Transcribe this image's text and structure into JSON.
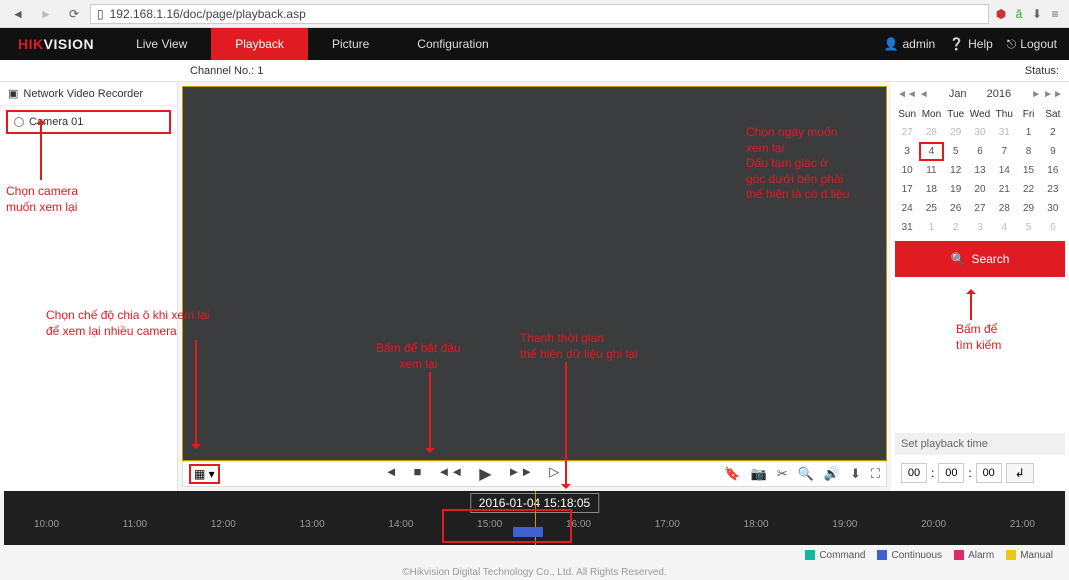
{
  "browser": {
    "url": "192.168.1.16/doc/page/playback.asp"
  },
  "logo": {
    "prefix": "HIK",
    "suffix": "VISION"
  },
  "nav": {
    "live": "Live View",
    "playback": "Playback",
    "picture": "Picture",
    "config": "Configuration"
  },
  "user": {
    "name": "admin",
    "help": "Help",
    "logout": "Logout"
  },
  "info": {
    "channel": "Channel No.: 1",
    "status": "Status:"
  },
  "sidebar": {
    "nvr": "Network Video Recorder",
    "cameras": [
      "Camera 01"
    ]
  },
  "calendar": {
    "month": "Jan",
    "year": "2016",
    "dow": [
      "Sun",
      "Mon",
      "Tue",
      "Wed",
      "Thu",
      "Fri",
      "Sat"
    ],
    "cells": [
      {
        "n": 27,
        "f": 1
      },
      {
        "n": 28,
        "f": 1
      },
      {
        "n": 29,
        "f": 1
      },
      {
        "n": 30,
        "f": 1
      },
      {
        "n": 31,
        "f": 1
      },
      {
        "n": 1
      },
      {
        "n": 2
      },
      {
        "n": 3
      },
      {
        "n": 4,
        "sel": 1
      },
      {
        "n": 5
      },
      {
        "n": 6
      },
      {
        "n": 7
      },
      {
        "n": 8
      },
      {
        "n": 9
      },
      {
        "n": 10
      },
      {
        "n": 11
      },
      {
        "n": 12
      },
      {
        "n": 13
      },
      {
        "n": 14
      },
      {
        "n": 15
      },
      {
        "n": 16
      },
      {
        "n": 17
      },
      {
        "n": 18
      },
      {
        "n": 19
      },
      {
        "n": 20
      },
      {
        "n": 21
      },
      {
        "n": 22
      },
      {
        "n": 23
      },
      {
        "n": 24
      },
      {
        "n": 25
      },
      {
        "n": 26
      },
      {
        "n": 27
      },
      {
        "n": 28
      },
      {
        "n": 29
      },
      {
        "n": 30
      },
      {
        "n": 31
      },
      {
        "n": 1,
        "f": 1
      },
      {
        "n": 2,
        "f": 1
      },
      {
        "n": 3,
        "f": 1
      },
      {
        "n": 4,
        "f": 1
      },
      {
        "n": 5,
        "f": 1
      },
      {
        "n": 6,
        "f": 1
      }
    ]
  },
  "search": "Search",
  "setPlayback": {
    "title": "Set playback time",
    "hh": "00",
    "mm": "00",
    "ss": "00"
  },
  "timeline": {
    "stamp": "2016-01-04 15:18:05",
    "hours": [
      "10:00",
      "11:00",
      "12:00",
      "13:00",
      "14:00",
      "15:00",
      "16:00",
      "17:00",
      "18:00",
      "19:00",
      "20:00",
      "21:00"
    ]
  },
  "legend": {
    "command": "Command",
    "continuous": "Continuous",
    "alarm": "Alarm",
    "manual": "Manual"
  },
  "footer": "©Hikvision Digital Technology Co., Ltd. All Rights Reserved.",
  "annotations": {
    "a1": "Chọn camera\nmuốn xem lại",
    "a2": "Chọn chế độ chia ô khi xem lại\nđể xem lại nhiều camera",
    "a3": "Bấm để bắt đầu\nxem lại",
    "a4": "Thanh thời gian\nthể hiện dữ liệu ghi lại",
    "a5": "Chọn ngày muốn\nxem lại\nDấu tam giác ở\ngóc dưới bên phải\nthể hiện là có d.liệu",
    "a6": "Bấm để\ntìm kiếm"
  }
}
